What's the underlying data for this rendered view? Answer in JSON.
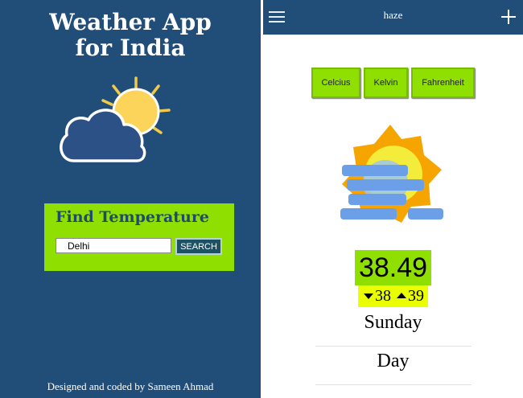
{
  "left_panel": {
    "title_line1": "Weather App",
    "title_line2": "for India",
    "hero_icon": "cloud-sun-icon",
    "find_title": "Find Temperature",
    "city_value": "Delhi",
    "search_label": "SEARCH",
    "footer": "Designed and coded by Sameen Ahmad"
  },
  "header": {
    "menu_icon": "hamburger-menu-icon",
    "title": "haze",
    "add_icon": "plus-icon"
  },
  "units": [
    "Celcius",
    "Kelvin",
    "Fahrenheit"
  ],
  "weather": {
    "icon": "haze-icon",
    "temperature": "38.49",
    "min": "38",
    "max": "39",
    "day": "Sunday",
    "period": "Day"
  },
  "colors": {
    "navy": "#214d79",
    "green": "#8fe000",
    "yellow": "#eaff00",
    "search_button": "#1f5164"
  }
}
